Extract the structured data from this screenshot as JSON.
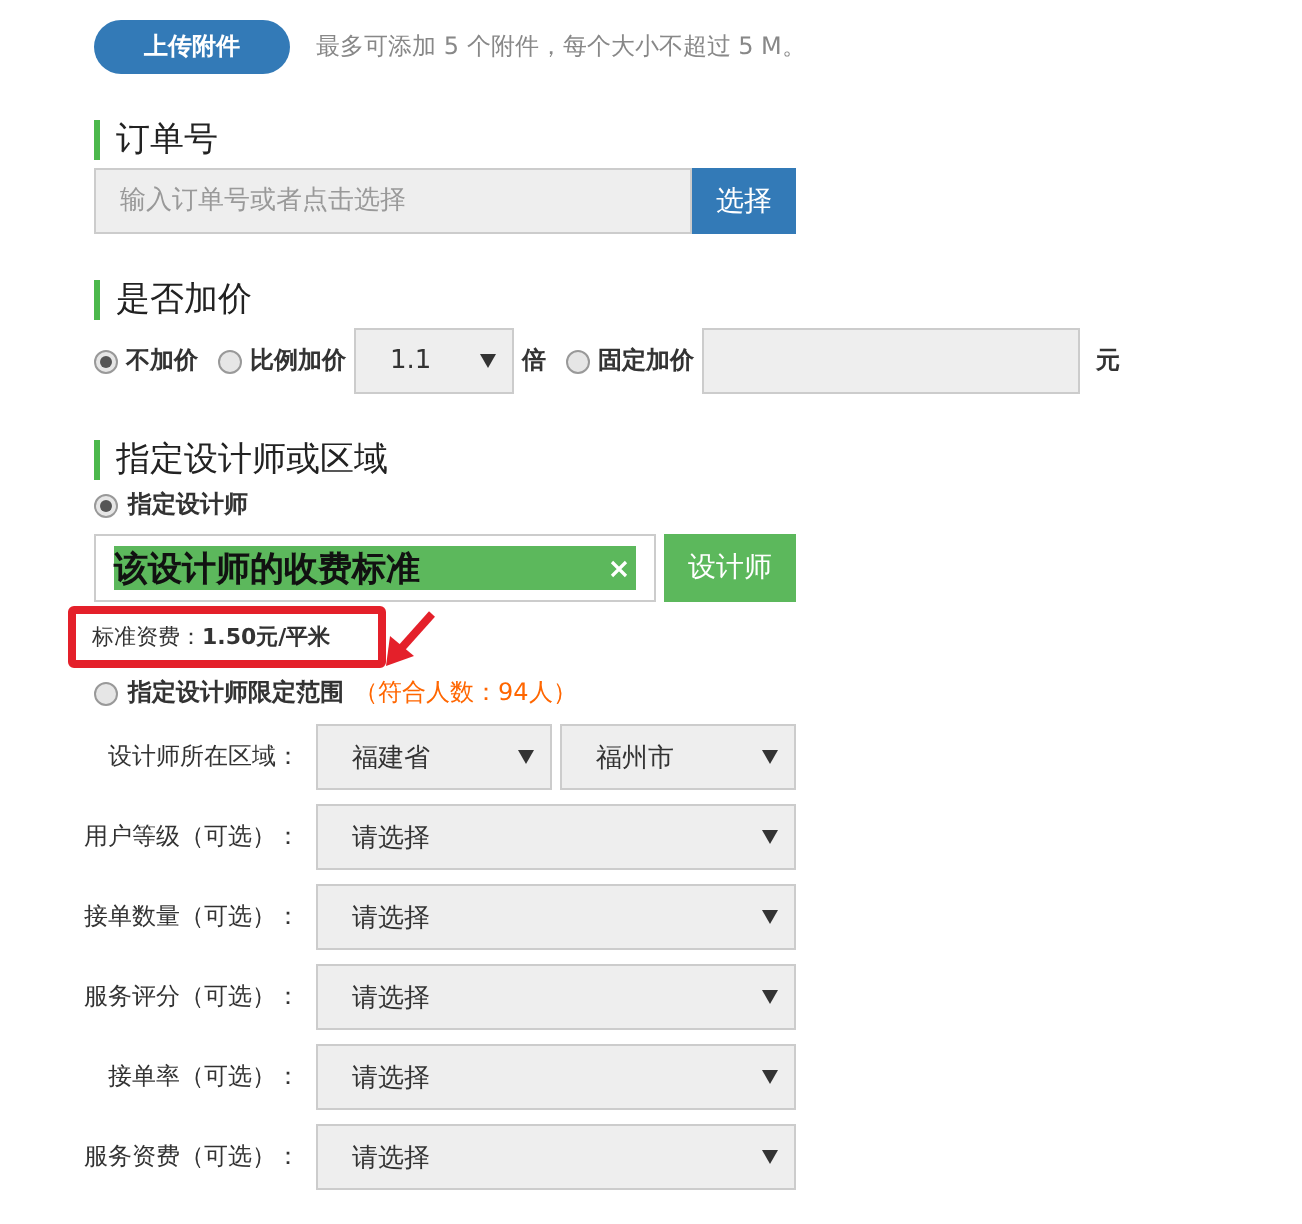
{
  "upload": {
    "button": "上传附件",
    "hint": "最多可添加 5 个附件，每个大小不超过 5 M。"
  },
  "order": {
    "heading": "订单号",
    "placeholder": "输入订单号或者点击选择",
    "button": "选择"
  },
  "markup": {
    "heading": "是否加价",
    "options": [
      {
        "kind": "plain",
        "label": "不加价",
        "selected": true
      },
      {
        "kind": "ratio",
        "label": "比例加价",
        "selected": false,
        "value": "1.1",
        "unit": "倍"
      },
      {
        "kind": "fixed",
        "label": "固定加价",
        "selected": false,
        "unit": "元"
      }
    ]
  },
  "designer": {
    "heading": "指定设计师或区域",
    "modes": [
      {
        "kind": "designer",
        "label": "指定设计师",
        "selected": true,
        "tag": "该设计师的收费标准",
        "button": "设计师",
        "fee": "标准资费：**1.50元/平米**"
      },
      {
        "kind": "range",
        "label": "指定设计师限定范围",
        "selected": false,
        "note": "（符合人数：94人）",
        "filters": [
          {
            "label": "设计师所在区域：",
            "values": [
              "福建省",
              "福州市"
            ]
          },
          {
            "label": "用户等级（可选）：",
            "values": [
              "请选择"
            ]
          },
          {
            "label": "接单数量（可选）：",
            "values": [
              "请选择"
            ]
          },
          {
            "label": "服务评分（可选）：",
            "values": [
              "请选择"
            ]
          },
          {
            "label": "接单率（可选）：",
            "values": [
              "请选择"
            ]
          },
          {
            "label": "服务资费（可选）：",
            "values": [
              "请选择"
            ]
          }
        ]
      }
    ]
  }
}
